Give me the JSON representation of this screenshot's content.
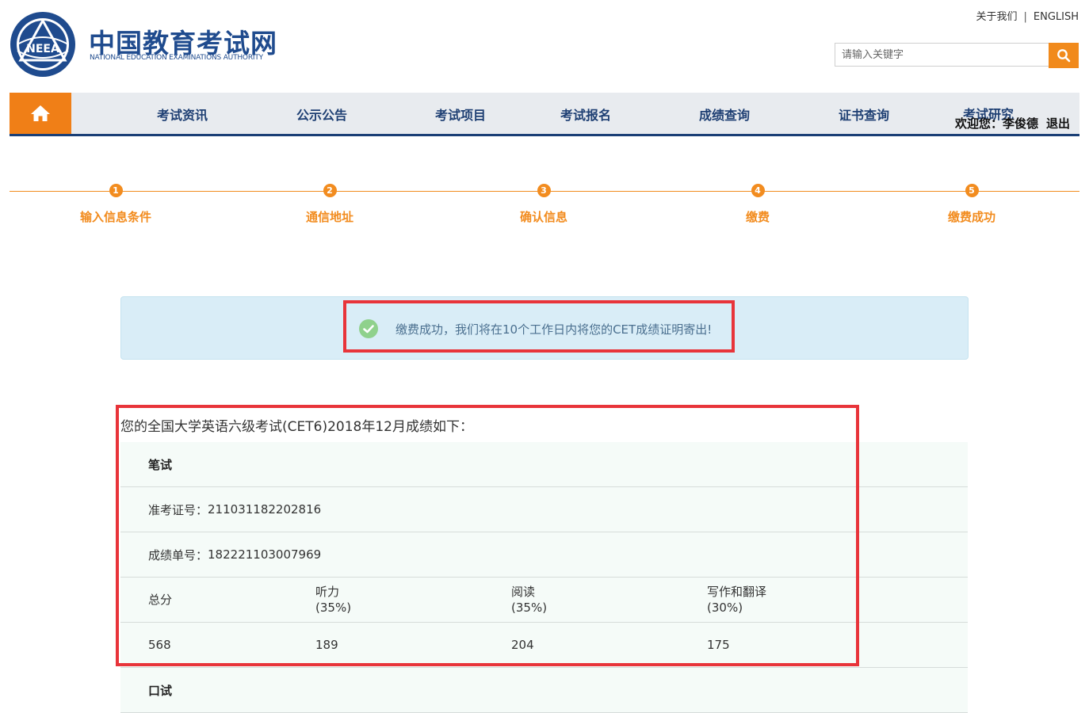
{
  "header": {
    "logo_cn": "中国教育考试网",
    "logo_en": "NATIONAL EDUCATION EXAMINATIONS AUTHORITY",
    "logo_badge": "NEEA",
    "top_links": [
      "关于我们",
      "ENGLISH"
    ],
    "search_placeholder": "请输入关键字"
  },
  "nav": {
    "items": [
      "考试资讯",
      "公示公告",
      "考试项目",
      "考试报名",
      "成绩查询",
      "证书查询",
      "考试研究"
    ],
    "welcome": "欢迎您：",
    "username": "李俊德",
    "logout": "退出"
  },
  "steps": [
    {
      "num": "1",
      "label": "输入信息条件"
    },
    {
      "num": "2",
      "label": "通信地址"
    },
    {
      "num": "3",
      "label": "确认信息"
    },
    {
      "num": "4",
      "label": "缴费"
    },
    {
      "num": "5",
      "label": "缴费成功"
    }
  ],
  "alert": {
    "message": "缴费成功，我们将在10个工作日内将您的CET成绩证明寄出!"
  },
  "score": {
    "title": "您的全国大学英语六级考试(CET6)2018年12月成绩如下：",
    "written_label": "笔试",
    "ticket_label": "准考证号：",
    "ticket_value": "211031182202816",
    "report_label": "成绩单号：",
    "report_value": "182221103007969",
    "headers": [
      {
        "name": "总分",
        "weight": ""
      },
      {
        "name": "听力",
        "weight": "(35%)"
      },
      {
        "name": "阅读",
        "weight": "(35%)"
      },
      {
        "name": "写作和翻译",
        "weight": "(30%)"
      }
    ],
    "values": [
      "568",
      "189",
      "204",
      "175"
    ],
    "oral_label": "口试"
  },
  "colors": {
    "brand_blue": "#1f4b8e",
    "accent_orange": "#f28c1f",
    "highlight_red": "#e8343a",
    "alert_bg": "#d9edf7"
  },
  "icons": [
    "home-icon",
    "search-icon",
    "check-circle-icon",
    "neea-emblem-icon"
  ]
}
